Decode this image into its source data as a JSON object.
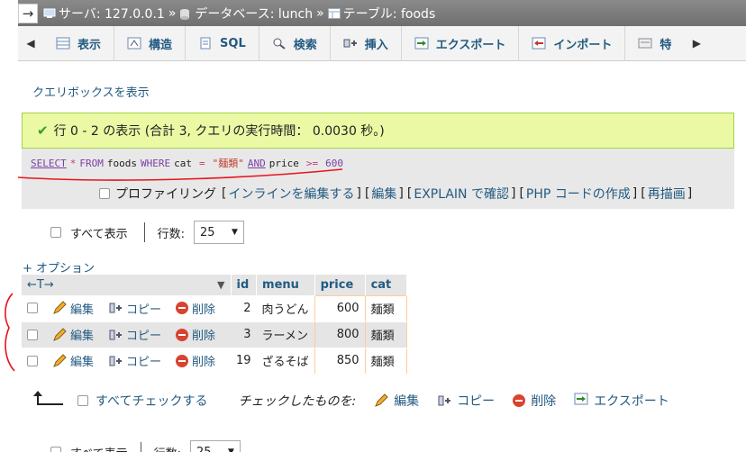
{
  "breadcrumb": {
    "server": "サーバ: 127.0.0.1",
    "database": "データベース: lunch",
    "table": "テーブル: foods",
    "separator": "»"
  },
  "tabs": [
    {
      "label": "表示",
      "icon": "browse-icon"
    },
    {
      "label": "構造",
      "icon": "structure-icon"
    },
    {
      "label": "SQL",
      "icon": "sql-icon"
    },
    {
      "label": "検索",
      "icon": "search-icon"
    },
    {
      "label": "挿入",
      "icon": "insert-icon"
    },
    {
      "label": "エクスポート",
      "icon": "export-icon"
    },
    {
      "label": "インポート",
      "icon": "import-icon"
    },
    {
      "label": "特",
      "icon": "operations-icon"
    }
  ],
  "query_box_link": "クエリボックスを表示",
  "success_message": "行 0 - 2 の表示 (合計 3, クエリの実行時間： 0.0030 秒。)",
  "sql": {
    "select": "SELECT",
    "star": "*",
    "from": "FROM",
    "table": "foods",
    "where": "WHERE",
    "col1": "cat",
    "eq": "=",
    "val1": "\"麺類\"",
    "and": "AND",
    "col2": "price",
    "gte": ">=",
    "val2": "600"
  },
  "toolbar": {
    "profiling": "プロファイリング",
    "inline_edit": "インラインを編集する",
    "edit": "編集",
    "explain": "EXPLAIN で確認",
    "php": "PHP コードの作成",
    "refresh": "再描画"
  },
  "controls": {
    "show_all": "すべて表示",
    "rows_label": "行数:",
    "rows_value": "25"
  },
  "options_link": "+ オプション",
  "table": {
    "headers": [
      "id",
      "menu",
      "price",
      "cat"
    ],
    "rows": [
      {
        "id": "2",
        "menu": "肉うどん",
        "price": "600",
        "cat": "麺類"
      },
      {
        "id": "3",
        "menu": "ラーメン",
        "price": "800",
        "cat": "麺類"
      },
      {
        "id": "19",
        "menu": "ざるそば",
        "price": "850",
        "cat": "麺類"
      }
    ],
    "row_actions": {
      "edit": "編集",
      "copy": "コピー",
      "delete": "削除"
    }
  },
  "bottom_bar": {
    "check_all": "すべてチェックする",
    "with_selected": "チェックしたものを:",
    "edit": "編集",
    "copy": "コピー",
    "delete": "削除",
    "export": "エクスポート"
  },
  "colors": {
    "link": "#235a81",
    "success_bg": "#ebf8a4",
    "annotation": "#e8141c"
  }
}
